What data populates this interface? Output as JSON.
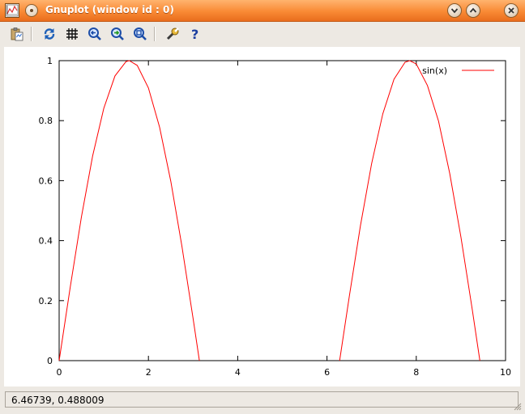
{
  "window": {
    "title": "Gnuplot (window id : 0)",
    "icon": "gnuplot-app-icon",
    "controls": [
      "minimize-icon",
      "maximize-icon",
      "close-icon"
    ]
  },
  "toolbar": {
    "buttons": [
      {
        "name": "copy-to-clipboard",
        "icon": "clipboard-icon"
      },
      {
        "name": "replot",
        "icon": "refresh-icon"
      },
      {
        "name": "toggle-grid",
        "icon": "grid-icon"
      },
      {
        "name": "previous-zoom",
        "icon": "zoom-previous-icon"
      },
      {
        "name": "next-zoom",
        "icon": "zoom-next-icon"
      },
      {
        "name": "unzoom",
        "icon": "zoom-reset-icon"
      },
      {
        "name": "preferences",
        "icon": "wrench-icon"
      },
      {
        "name": "help",
        "icon": "help-icon"
      }
    ]
  },
  "status": {
    "coordinates": "6.46739,  0.488009"
  },
  "colors": {
    "titlebar": "#f98a34",
    "series": "#ff0000",
    "background": "#ede9e3"
  },
  "chart_data": {
    "type": "line",
    "title": "",
    "xlabel": "",
    "ylabel": "",
    "xlim": [
      0,
      10
    ],
    "ylim": [
      0,
      1
    ],
    "xticks": [
      0,
      2,
      4,
      6,
      8,
      10
    ],
    "yticks": [
      0,
      0.2,
      0.4,
      0.6,
      0.8,
      1
    ],
    "grid": false,
    "legend_position": "top-right",
    "series": [
      {
        "name": "sin(x)",
        "color": "#ff0000",
        "x": [
          0,
          0.25,
          0.5,
          0.75,
          1.0,
          1.25,
          1.5,
          1.5708,
          1.75,
          2.0,
          2.25,
          2.5,
          2.75,
          3.0,
          3.1416,
          6.2832,
          6.5,
          6.75,
          7.0,
          7.25,
          7.5,
          7.75,
          7.854,
          8.0,
          8.25,
          8.5,
          8.75,
          9.0,
          9.25,
          9.4248
        ],
        "y": [
          0,
          0.247,
          0.479,
          0.682,
          0.841,
          0.949,
          0.997,
          1.0,
          0.984,
          0.909,
          0.778,
          0.598,
          0.382,
          0.141,
          0,
          0,
          0.215,
          0.45,
          0.657,
          0.823,
          0.938,
          0.995,
          1.0,
          0.989,
          0.917,
          0.798,
          0.624,
          0.412,
          0.174,
          0
        ]
      }
    ]
  }
}
